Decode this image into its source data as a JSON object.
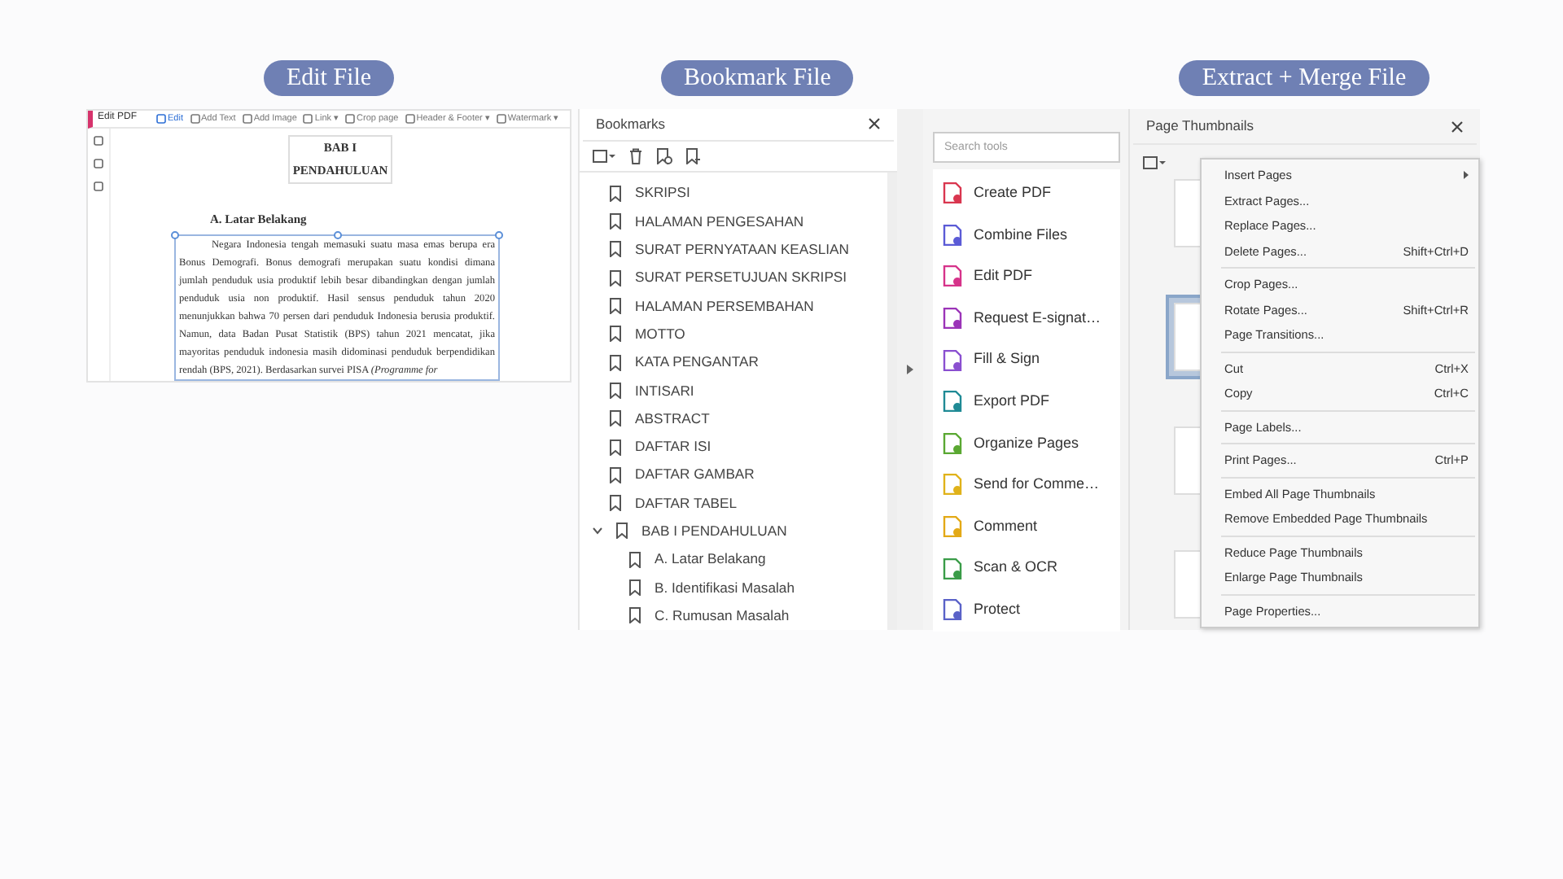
{
  "headings": [
    "Edit File",
    "Bookmark File",
    "Extract + Merge File"
  ],
  "edit_pdf": {
    "title": "Edit PDF",
    "toolbar": [
      {
        "label": "Edit",
        "selected": true
      },
      {
        "label": "Add Text",
        "selected": false
      },
      {
        "label": "Add Image",
        "selected": false
      },
      {
        "label": "Link ▾",
        "selected": false
      },
      {
        "label": "Crop page",
        "selected": false
      },
      {
        "label": "Header & Footer ▾",
        "selected": false
      },
      {
        "label": "Watermark ▾",
        "selected": false
      }
    ],
    "page_title": [
      "BAB I",
      "PENDAHULUAN"
    ],
    "subheading": "A. Latar Belakang",
    "paragraph": "Negara Indonesia tengah memasuki suatu masa emas berupa era Bonus Demografi. Bonus demografi merupakan suatu kondisi dimana jumlah penduduk usia produktif lebih besar dibandingkan dengan jumlah penduduk usia non produktif. Hasil sensus penduduk tahun 2020 menunjukkan bahwa 70 persen dari penduduk Indonesia berusia produktif. Namun, data Badan Pusat Statistik (BPS) tahun 2021 mencatat, jika mayoritas penduduk indonesia masih didominasi penduduk berpendidikan rendah (BPS, 2021). Berdasarkan survei PISA *(Programme for*"
  },
  "bookmarks": {
    "title": "Bookmarks",
    "items": [
      {
        "label": "SKRIPSI"
      },
      {
        "label": "HALAMAN PENGESAHAN"
      },
      {
        "label": "SURAT PERNYATAAN KEASLIAN"
      },
      {
        "label": "SURAT PERSETUJUAN SKRIPSI"
      },
      {
        "label": "HALAMAN PERSEMBAHAN"
      },
      {
        "label": "MOTTO"
      },
      {
        "label": "KATA PENGANTAR"
      },
      {
        "label": "INTISARI"
      },
      {
        "label": "ABSTRACT"
      },
      {
        "label": "DAFTAR ISI"
      },
      {
        "label": "DAFTAR GAMBAR"
      },
      {
        "label": "DAFTAR TABEL"
      },
      {
        "label": "BAB I  PENDAHULUAN",
        "expanded": true,
        "children": [
          {
            "label": "A. Latar Belakang"
          },
          {
            "label": "B. Identifikasi Masalah"
          },
          {
            "label": "C. Rumusan Masalah"
          }
        ]
      }
    ]
  },
  "tools": {
    "search": {
      "placeholder": "Search tools"
    },
    "items": [
      {
        "label": "Create PDF",
        "color": "#d9364f"
      },
      {
        "label": "Combine Files",
        "color": "#5b5bd6"
      },
      {
        "label": "Edit PDF",
        "color": "#d6338a"
      },
      {
        "label": "Request E-signat…",
        "color": "#9b34b8"
      },
      {
        "label": "Fill & Sign",
        "color": "#8a4fd0"
      },
      {
        "label": "Export PDF",
        "color": "#1f8a95"
      },
      {
        "label": "Organize Pages",
        "color": "#5aa832"
      },
      {
        "label": "Send for Comme…",
        "color": "#e0b21a"
      },
      {
        "label": "Comment",
        "color": "#e3a916"
      },
      {
        "label": "Scan & OCR",
        "color": "#3a9c48"
      },
      {
        "label": "Protect",
        "color": "#5a62c8"
      }
    ]
  },
  "thumbnails": {
    "title": "Page Thumbnails",
    "pages": [
      {
        "selected": false
      },
      {
        "selected": true
      },
      {
        "selected": false
      },
      {
        "selected": false
      }
    ],
    "menu": [
      [
        {
          "label": "Insert Pages",
          "submenu": true
        },
        {
          "label": "Extract Pages..."
        },
        {
          "label": "Replace Pages..."
        },
        {
          "label": "Delete Pages...",
          "shortcut": "Shift+Ctrl+D"
        }
      ],
      [
        {
          "label": "Crop Pages..."
        },
        {
          "label": "Rotate Pages...",
          "shortcut": "Shift+Ctrl+R"
        },
        {
          "label": "Page Transitions..."
        }
      ],
      [
        {
          "label": "Cut",
          "shortcut": "Ctrl+X"
        },
        {
          "label": "Copy",
          "shortcut": "Ctrl+C"
        }
      ],
      [
        {
          "label": "Page Labels..."
        }
      ],
      [
        {
          "label": "Print Pages...",
          "shortcut": "Ctrl+P"
        }
      ],
      [
        {
          "label": "Embed All Page Thumbnails"
        },
        {
          "label": "Remove Embedded Page Thumbnails"
        }
      ],
      [
        {
          "label": "Reduce Page Thumbnails"
        },
        {
          "label": "Enlarge Page Thumbnails"
        }
      ],
      [
        {
          "label": "Page Properties..."
        }
      ]
    ]
  }
}
